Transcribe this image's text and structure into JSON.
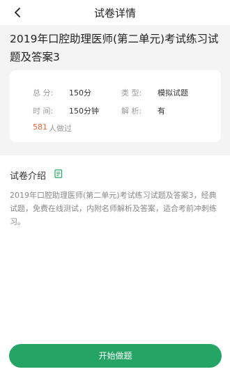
{
  "nav": {
    "title": "试卷详情"
  },
  "exam": {
    "title": "2019年口腔助理医师(第二单元)考试练习试题及答案3",
    "total_label": "总   分:",
    "total_value": "150分",
    "type_label": "类   型:",
    "type_value": "模拟试题",
    "time_label": "时   间:",
    "time_value": "150分钟",
    "analysis_label": "解   析:",
    "analysis_value": "有",
    "done_count": "581",
    "done_text": "人做过"
  },
  "intro": {
    "heading": "试卷介绍",
    "body": "2019年口腔助理医师(第二单元)考试练习试题及答案3，经典试题，免费在线测试，内附名师解析及答案，适合考前冲刺练习。"
  },
  "actions": {
    "start_label": "开始做题"
  },
  "colors": {
    "accent": "#25a565",
    "count": "#e0663b"
  },
  "icons": {
    "back": "chevron-left-icon",
    "intro": "document-icon"
  }
}
